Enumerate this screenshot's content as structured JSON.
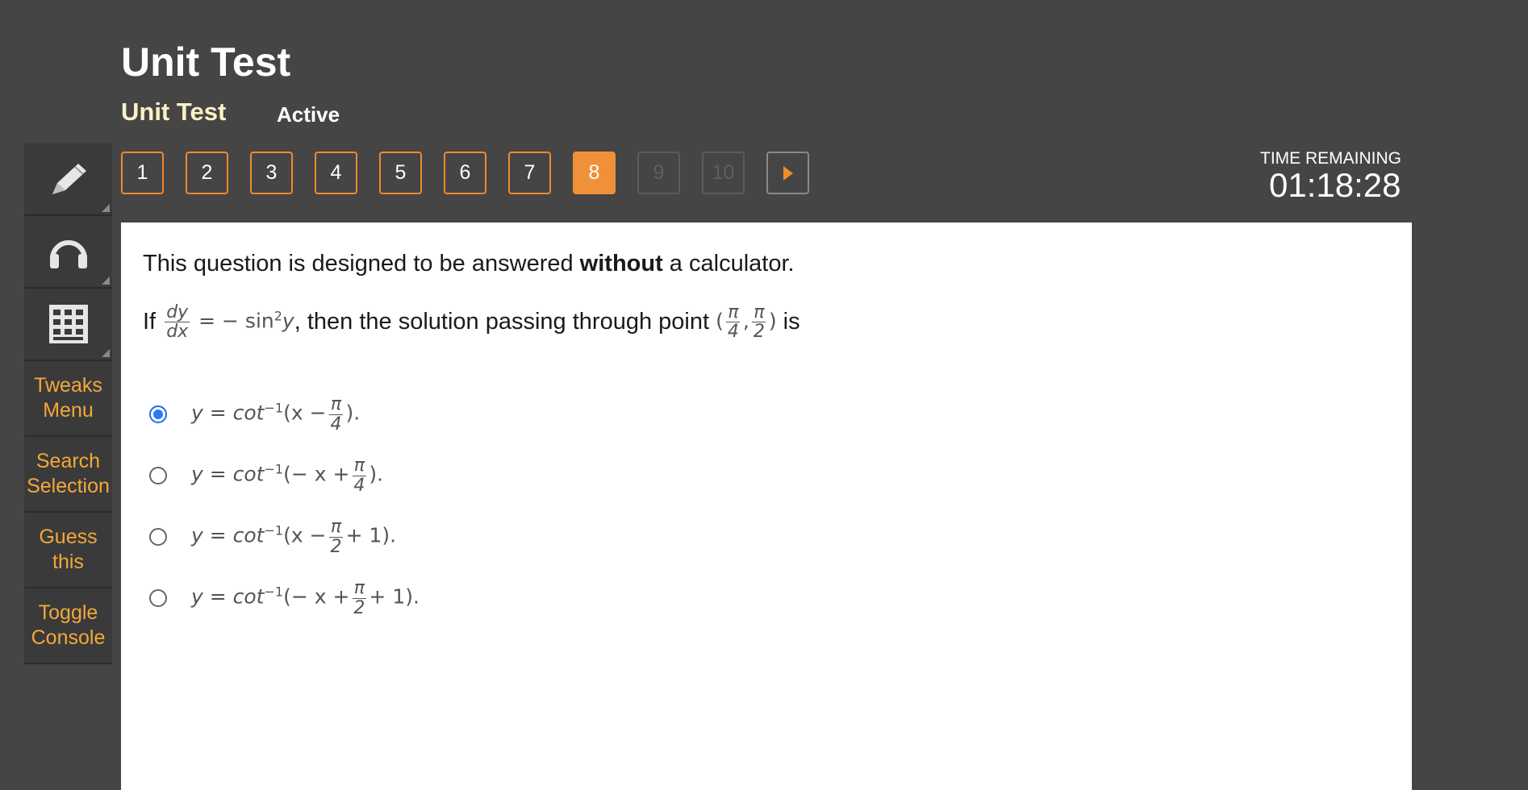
{
  "header": {
    "title": "Unit Test",
    "subtitle": "Unit Test",
    "status": "Active"
  },
  "sidebar": {
    "tools": [
      {
        "icon": "pencil-icon"
      },
      {
        "icon": "headphones-icon"
      },
      {
        "icon": "calculator-grid-icon"
      }
    ],
    "text_items": [
      {
        "line1": "Tweaks",
        "line2": "Menu"
      },
      {
        "line1": "Search",
        "line2": "Selection"
      },
      {
        "line1": "Guess",
        "line2": "this"
      },
      {
        "line1": "Toggle",
        "line2": "Console"
      }
    ]
  },
  "nav": {
    "questions": [
      "1",
      "2",
      "3",
      "4",
      "5",
      "6",
      "7",
      "8",
      "9",
      "10"
    ],
    "current": "8",
    "next_icon": "play-arrow-icon"
  },
  "timer": {
    "label": "TIME REMAINING",
    "value": "01:18:28"
  },
  "question": {
    "instruction_pre": "This question is designed to be answered ",
    "instruction_bold": "without",
    "instruction_post": " a calculator.",
    "prefix": "If",
    "dy": "dy",
    "dx": "dx",
    "rhs": "= − sin",
    "exp2": "2",
    "rhs_var": "y",
    "middle": ", then the solution passing through point",
    "pi": "π",
    "four": "4",
    "two": "2",
    "suffix": "is"
  },
  "options": [
    {
      "selected": true,
      "pre": "y = cot",
      "exp": "−1",
      "open": "(x −",
      "den": "4",
      "post": ")."
    },
    {
      "selected": false,
      "pre": "y = cot",
      "exp": "−1",
      "open": "(− x +",
      "den": "4",
      "post": ")."
    },
    {
      "selected": false,
      "pre": "y = cot",
      "exp": "−1",
      "open": "(x −",
      "den": "2",
      "post": "+ 1)."
    },
    {
      "selected": false,
      "pre": "y = cot",
      "exp": "−1",
      "open": "(− x +",
      "den": "2",
      "post": "+ 1)."
    }
  ],
  "colors": {
    "background": "#454545",
    "accent": "#f08a2c",
    "selected_radio": "#2a7cf0",
    "subtitle": "#fdf2c4"
  }
}
